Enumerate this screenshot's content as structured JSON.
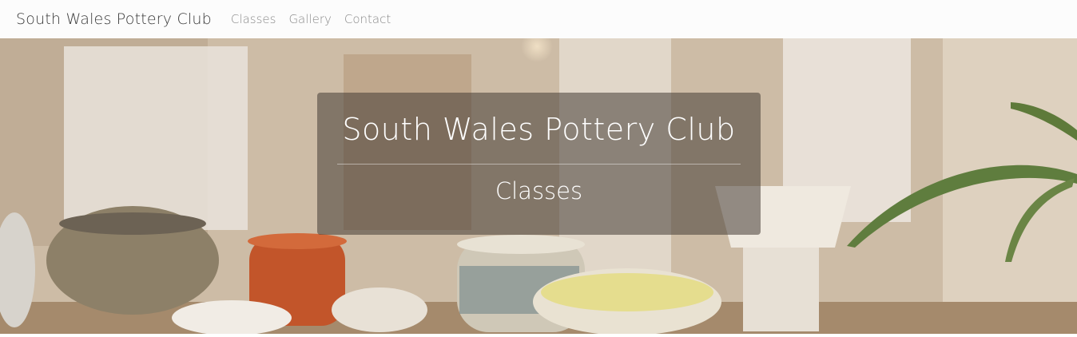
{
  "navbar": {
    "brand": "South Wales Pottery Club",
    "links": [
      "Classes",
      "Gallery",
      "Contact"
    ]
  },
  "hero": {
    "title": "South Wales Pottery Club",
    "subtitle": "Classes"
  },
  "colors": {
    "navbar_bg": "#fcfcfc",
    "brand_text": "#3a3a3a",
    "nav_link_text": "#8a8a8a",
    "panel_bg": "rgba(70,60,52,0.55)"
  }
}
